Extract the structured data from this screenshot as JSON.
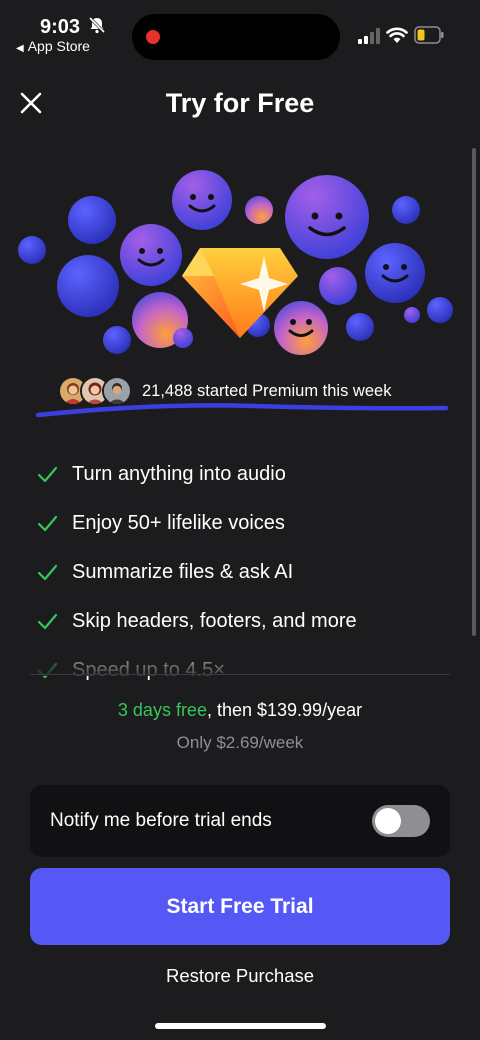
{
  "status_bar": {
    "time": "9:03",
    "back_app": "App Store",
    "icons": [
      "bell-off-icon",
      "recording-dot-icon",
      "signal-icon",
      "wifi-icon",
      "battery-low-icon"
    ]
  },
  "header": {
    "title": "Try for Free",
    "close_icon": "close-icon"
  },
  "social_proof": {
    "text": "21,488 started Premium this week"
  },
  "features": [
    {
      "label": "Turn anything into audio",
      "icon": "checkmark-icon"
    },
    {
      "label": "Enjoy 50+ lifelike voices",
      "icon": "checkmark-icon"
    },
    {
      "label": "Summarize files & ask AI",
      "icon": "checkmark-icon"
    },
    {
      "label": "Skip headers, footers, and more",
      "icon": "checkmark-icon"
    },
    {
      "label": "Speed up to 4.5×",
      "icon": "checkmark-icon"
    }
  ],
  "pricing": {
    "trial": "3 days free",
    "rest": ", then $139.99/year",
    "weekly": "Only $2.69/week"
  },
  "notify": {
    "label": "Notify me before trial ends",
    "enabled": false
  },
  "cta": {
    "label": "Start Free Trial"
  },
  "restore": {
    "label": "Restore Purchase"
  },
  "colors": {
    "background": "#1c1c1e",
    "accent": "#5558f5",
    "trial_green": "#34c759",
    "check_green": "#34c759",
    "muted": "#8e8e93",
    "underline": "#3b3fe0"
  }
}
